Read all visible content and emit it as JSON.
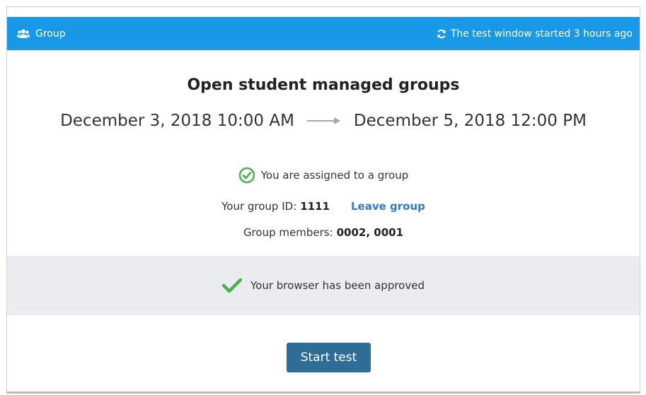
{
  "header": {
    "group_label": "Group",
    "window_status": "The test window started 3 hours ago",
    "group_icon": "users-icon",
    "refresh_icon": "refresh-icon",
    "background_color": "#1a98e8"
  },
  "main": {
    "title": "Open student managed groups",
    "start_date": "December 3, 2018 10:00 AM",
    "end_date": "December 5, 2018 12:00 PM",
    "assigned_text": "You are assigned to a group",
    "group_id_label": "Your group ID:",
    "group_id_value": "1111",
    "leave_group_label": "Leave group",
    "members_label": "Group members:",
    "members_value": "0002, 0001"
  },
  "browser_check": {
    "approved_text": "Your browser has been approved",
    "check_color": "#4caf50"
  },
  "actions": {
    "start_label": "Start test",
    "button_color": "#2d6d97"
  }
}
